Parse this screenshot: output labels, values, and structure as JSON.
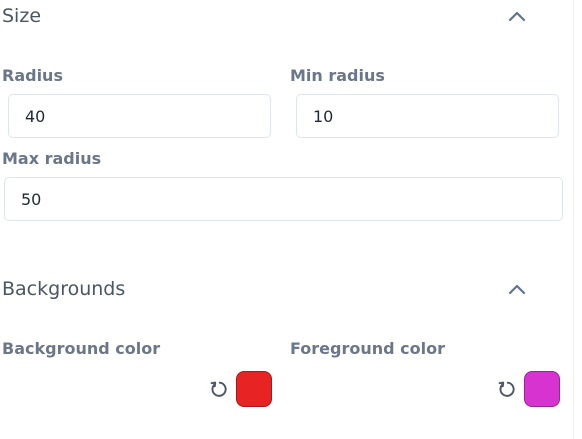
{
  "size_section": {
    "title": "Size",
    "collapse_icon": "chevron-up-icon",
    "radius": {
      "label": "Radius",
      "value": "40"
    },
    "min_radius": {
      "label": "Min radius",
      "value": "10"
    },
    "max_radius": {
      "label": "Max radius",
      "value": "50"
    }
  },
  "backgrounds_section": {
    "title": "Backgrounds",
    "collapse_icon": "chevron-up-icon",
    "background_color": {
      "label": "Background color",
      "reset_icon": "reset-icon",
      "color": "#e82323"
    },
    "foreground_color": {
      "label": "Foreground color",
      "reset_icon": "reset-icon",
      "color": "#d633d1"
    }
  }
}
